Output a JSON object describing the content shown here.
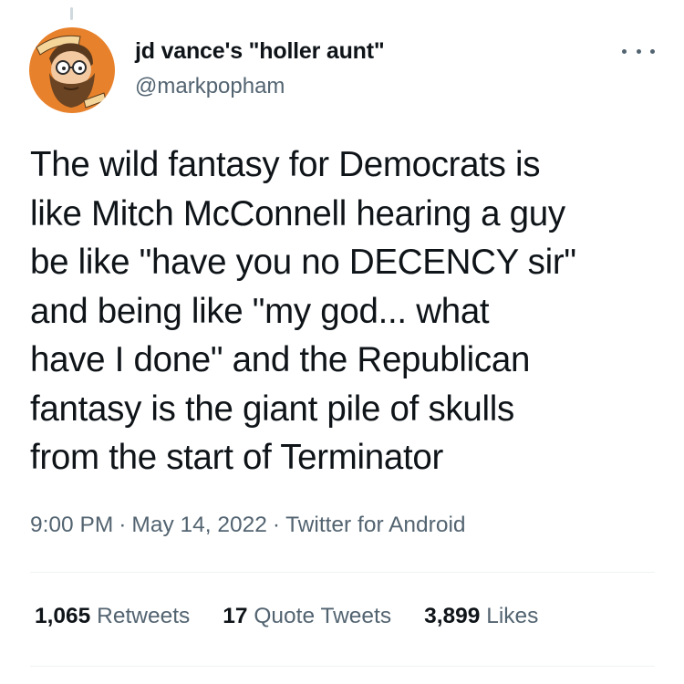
{
  "author": {
    "display_name": "jd vance's \"holler aunt\"",
    "handle": "@markpopham",
    "avatar": "cartoon-bearded-man-avatar"
  },
  "tweet": {
    "text": "The wild fantasy for Democrats is\nlike Mitch McConnell hearing a guy\nbe like \"have you no DECENCY sir\"\nand being like \"my god... what\nhave I done\" and the Republican\nfantasy is the giant pile of skulls\nfrom the start of Terminator",
    "time": "9:00 PM",
    "date": "May 14, 2022",
    "source": "Twitter for Android",
    "separator": "·"
  },
  "stats": {
    "retweets_count": "1,065",
    "retweets_label": "Retweets",
    "quotes_count": "17",
    "quotes_label": "Quote Tweets",
    "likes_count": "3,899",
    "likes_label": "Likes"
  },
  "colors": {
    "text_primary": "#0f1419",
    "text_secondary": "#536471",
    "divider": "#eff3f4",
    "avatar_background": "#e8812b"
  }
}
